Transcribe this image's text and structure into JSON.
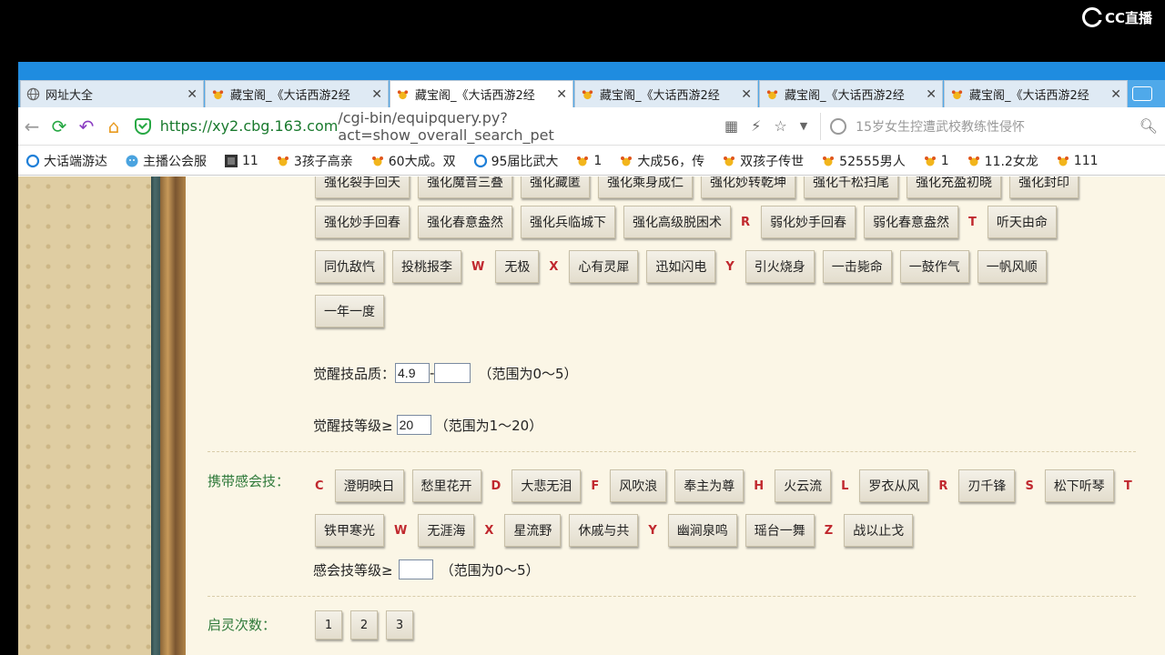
{
  "overlay": {
    "brand": "CC直播"
  },
  "tabs": [
    {
      "label": "网址大全",
      "icon": "globe-icon",
      "active": false
    },
    {
      "label": "藏宝阁_《大话西游2经",
      "icon": "game-icon",
      "active": false
    },
    {
      "label": "藏宝阁_《大话西游2经",
      "icon": "game-icon",
      "active": true
    },
    {
      "label": "藏宝阁_《大话西游2经",
      "icon": "game-icon",
      "active": false
    },
    {
      "label": "藏宝阁_《大话西游2经",
      "icon": "game-icon",
      "active": false
    },
    {
      "label": "藏宝阁_《大话西游2经",
      "icon": "game-icon",
      "active": false
    }
  ],
  "address": {
    "url_main": "https://xy2.cbg.163.com",
    "url_rest": "/cgi-bin/equipquery.py?act=show_overall_search_pet"
  },
  "search": {
    "text": "15岁女生控遭武校教练性侵怀"
  },
  "bookmarks": [
    {
      "label": "大话端游达",
      "icon": "refresh-icon"
    },
    {
      "label": "主播公会服",
      "icon": "face-icon"
    },
    {
      "label": "11",
      "icon": "dark-icon"
    },
    {
      "label": "3孩子高亲",
      "icon": "game-icon"
    },
    {
      "label": "60大成。双",
      "icon": "game-icon"
    },
    {
      "label": "95届比武大",
      "icon": "refresh-icon"
    },
    {
      "label": "1",
      "icon": "game-icon"
    },
    {
      "label": "大成56，传",
      "icon": "game-icon"
    },
    {
      "label": "双孩子传世",
      "icon": "game-icon"
    },
    {
      "label": "52555男人",
      "icon": "game-icon"
    },
    {
      "label": "1",
      "icon": "game-icon"
    },
    {
      "label": "11.2女龙",
      "icon": "game-icon"
    },
    {
      "label": "111",
      "icon": "game-icon"
    }
  ],
  "skills_row0": [
    "强化裂手回天",
    "强化魔音三叠",
    "强化藏匿",
    "强化乘身成仁",
    "强化妙转乾坤",
    "强化千松扫尾",
    "强化充盈初晓",
    "强化封印"
  ],
  "skills_row1": [
    {
      "type": "btn",
      "text": "强化妙手回春"
    },
    {
      "type": "btn",
      "text": "强化春意盎然"
    },
    {
      "type": "btn",
      "text": "强化兵临城下"
    },
    {
      "type": "btn",
      "text": "强化高级脱困术"
    },
    {
      "type": "letter",
      "text": "R"
    },
    {
      "type": "btn",
      "text": "弱化妙手回春"
    },
    {
      "type": "btn",
      "text": "弱化春意盎然"
    },
    {
      "type": "letter",
      "text": "T"
    },
    {
      "type": "btn",
      "text": "听天由命"
    }
  ],
  "skills_row2": [
    {
      "type": "btn",
      "text": "同仇敌忾"
    },
    {
      "type": "btn",
      "text": "投桃报李"
    },
    {
      "type": "letter",
      "text": "W"
    },
    {
      "type": "btn",
      "text": "无极"
    },
    {
      "type": "letter",
      "text": "X"
    },
    {
      "type": "btn",
      "text": "心有灵犀"
    },
    {
      "type": "btn",
      "text": "迅如闪电"
    },
    {
      "type": "letter",
      "text": "Y"
    },
    {
      "type": "btn",
      "text": "引火烧身"
    },
    {
      "type": "btn",
      "text": "一击毙命"
    },
    {
      "type": "btn",
      "text": "一鼓作气"
    },
    {
      "type": "btn",
      "text": "一帆风顺"
    }
  ],
  "skills_row3": [
    {
      "type": "btn",
      "text": "一年一度"
    }
  ],
  "awaken_quality": {
    "label": "觉醒技品质：",
    "min": "4.9",
    "dash": "-",
    "max": "",
    "hint": "（范围为0～5）"
  },
  "awaken_level": {
    "label": "觉醒技等级≥",
    "value": "20",
    "hint": "（范围为1～20）"
  },
  "carry_section": {
    "title": "携带感会技："
  },
  "carry_row1": [
    {
      "type": "letter",
      "text": "C"
    },
    {
      "type": "btn",
      "text": "澄明映日"
    },
    {
      "type": "btn",
      "text": "愁里花开"
    },
    {
      "type": "letter",
      "text": "D"
    },
    {
      "type": "btn",
      "text": "大悲无泪"
    },
    {
      "type": "letter",
      "text": "F"
    },
    {
      "type": "btn",
      "text": "风吹浪"
    },
    {
      "type": "btn",
      "text": "奉主为尊"
    },
    {
      "type": "letter",
      "text": "H"
    },
    {
      "type": "btn",
      "text": "火云流"
    },
    {
      "type": "letter",
      "text": "L"
    },
    {
      "type": "btn",
      "text": "罗衣从风"
    },
    {
      "type": "letter",
      "text": "R"
    },
    {
      "type": "btn",
      "text": "刃千锋"
    },
    {
      "type": "letter",
      "text": "S"
    },
    {
      "type": "btn",
      "text": "松下听琴"
    },
    {
      "type": "letter",
      "text": "T"
    }
  ],
  "carry_row2": [
    {
      "type": "btn",
      "text": "铁甲寒光"
    },
    {
      "type": "letter",
      "text": "W"
    },
    {
      "type": "btn",
      "text": "无涯海"
    },
    {
      "type": "letter",
      "text": "X"
    },
    {
      "type": "btn",
      "text": "星流野"
    },
    {
      "type": "btn",
      "text": "休戚与共"
    },
    {
      "type": "letter",
      "text": "Y"
    },
    {
      "type": "btn",
      "text": "幽涧泉鸣"
    },
    {
      "type": "btn",
      "text": "瑶台一舞"
    },
    {
      "type": "letter",
      "text": "Z"
    },
    {
      "type": "btn",
      "text": "战以止戈"
    }
  ],
  "carry_level": {
    "label": "感会技等级≥",
    "value": "",
    "hint": "（范围为0～5）"
  },
  "qiling": {
    "title": "启灵次数：",
    "options": [
      "1",
      "2",
      "3"
    ]
  }
}
